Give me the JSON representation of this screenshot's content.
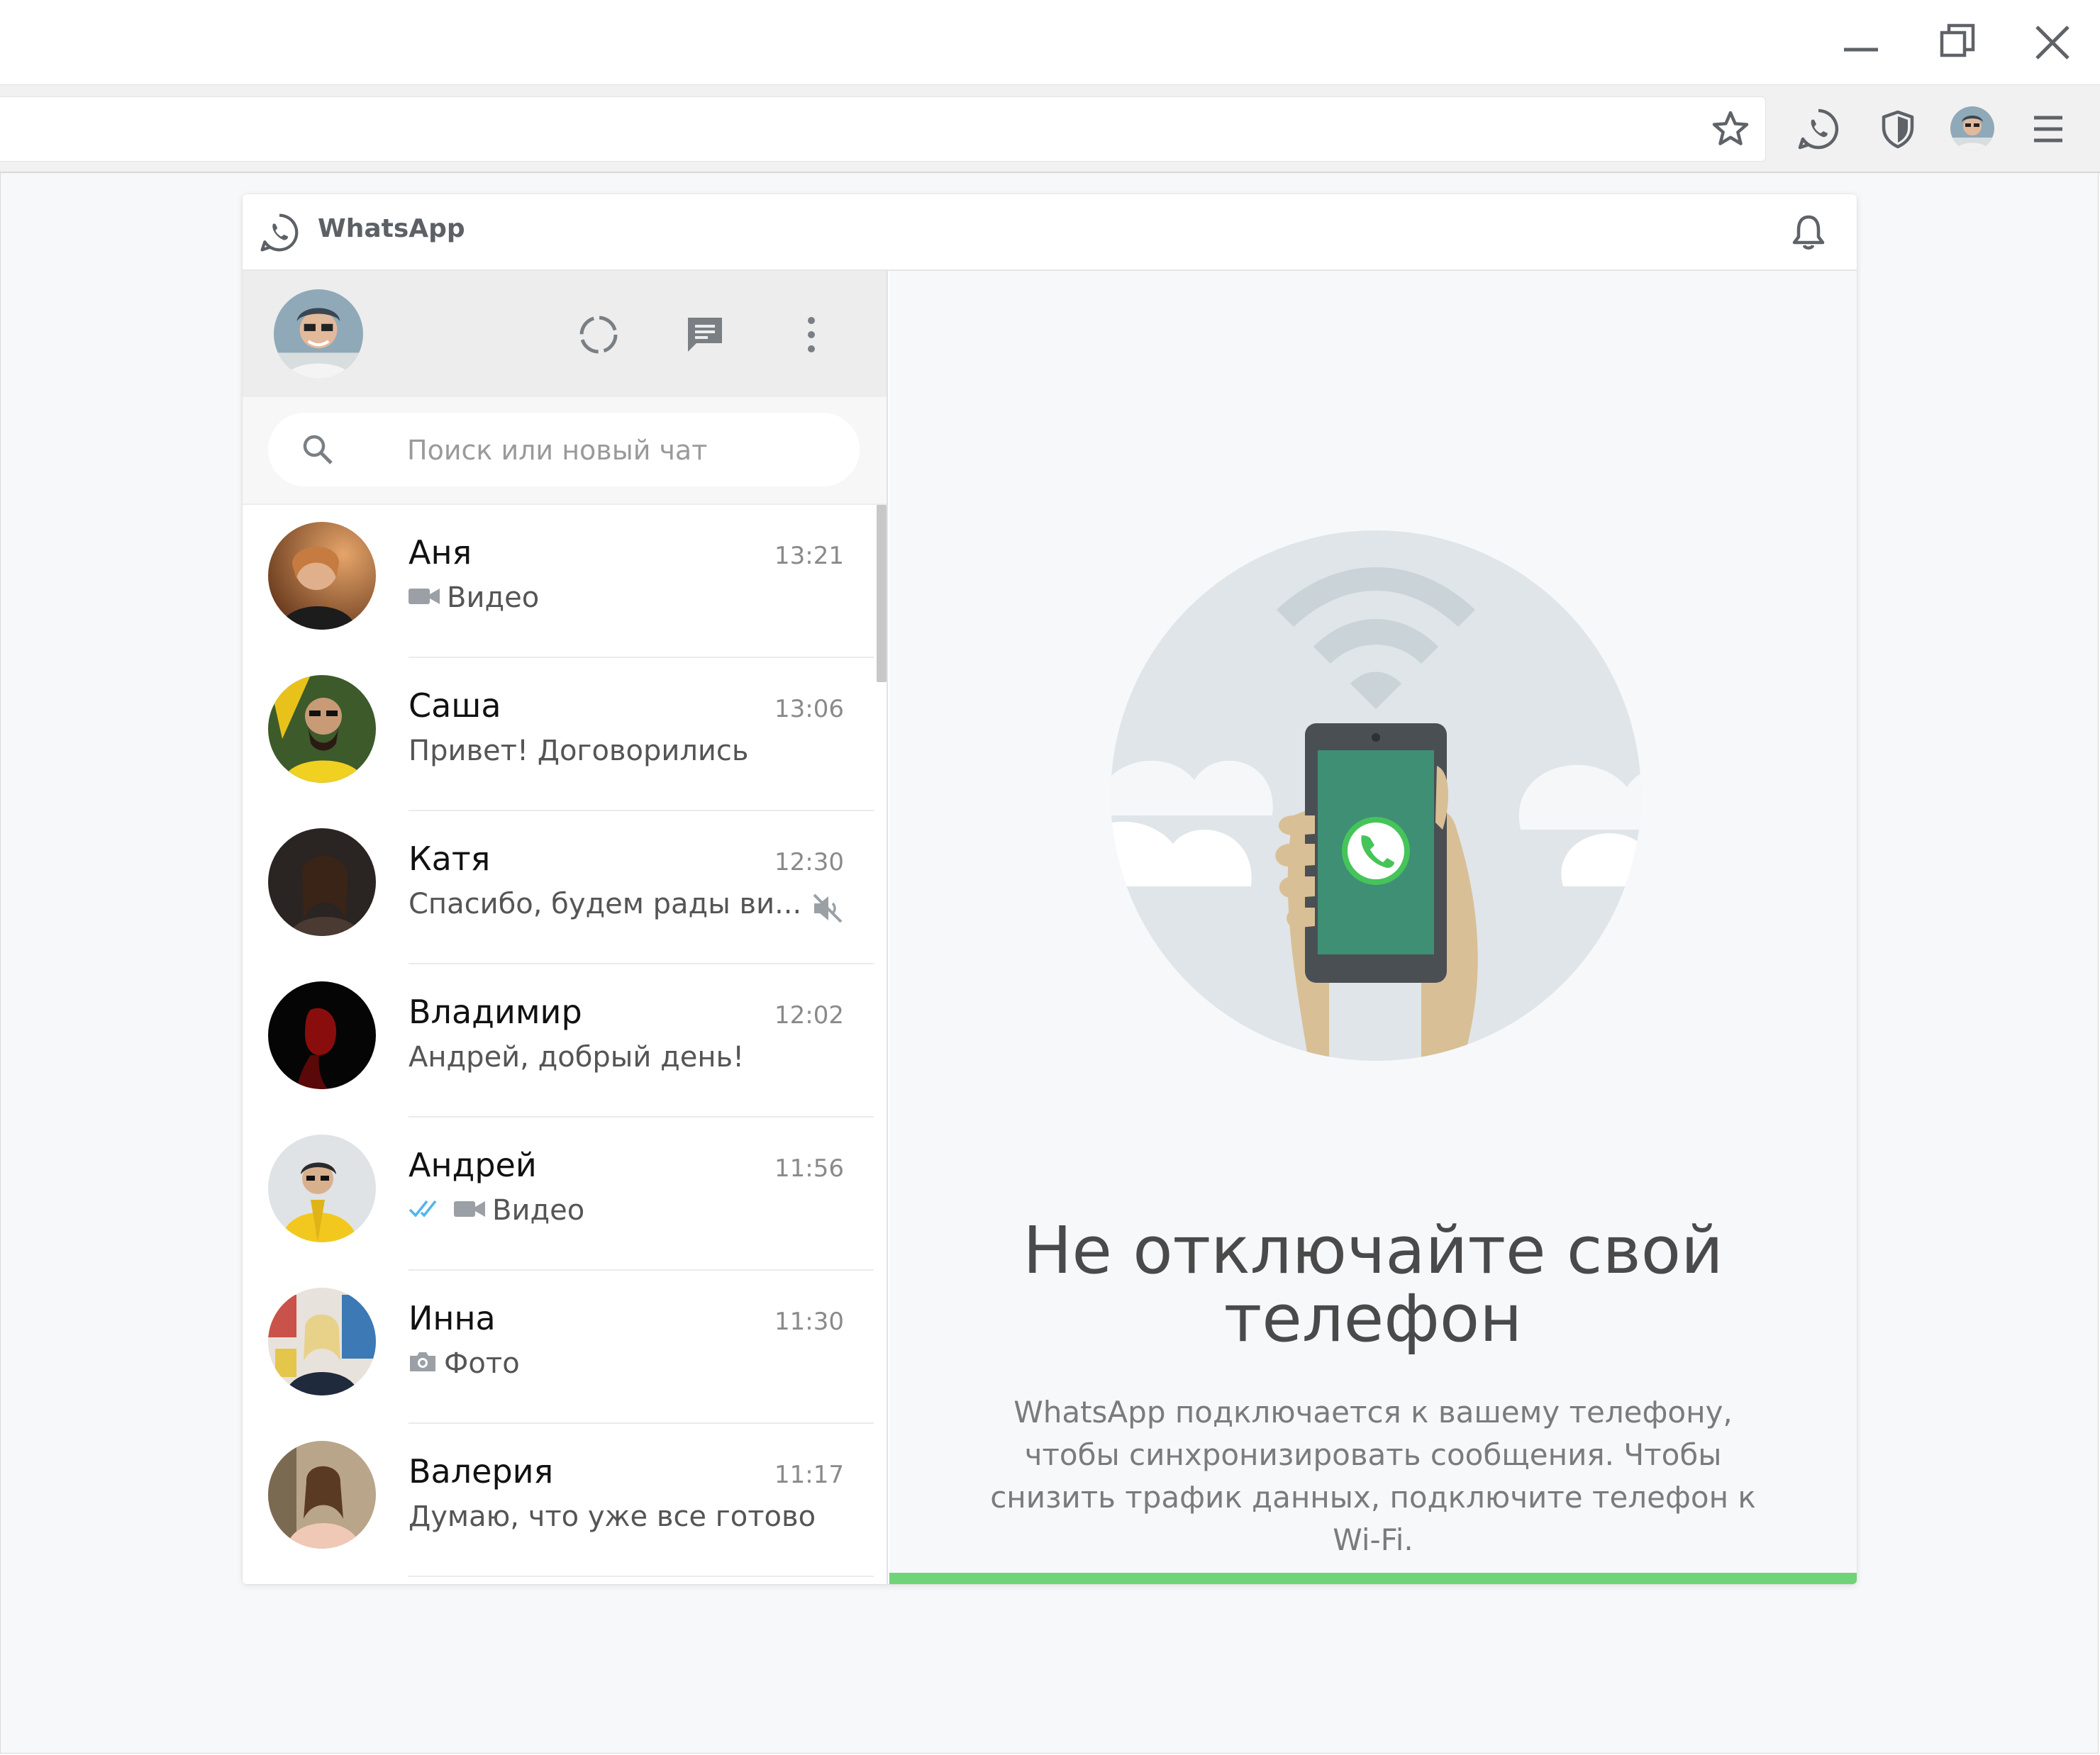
{
  "app": {
    "title": "WhatsApp",
    "accent_color": "#6fd478",
    "header_icon": "whatsapp-logo-icon"
  },
  "browser": {
    "window_controls": [
      "minimize-icon",
      "restore-icon",
      "close-icon"
    ],
    "toolbar_icons": [
      "star-icon",
      "whatsapp-extension-icon",
      "shield-icon",
      "profile-avatar",
      "menu-icon"
    ]
  },
  "sidebar": {
    "header_icons": [
      "status-icon",
      "new-chat-icon",
      "menu-dots-icon"
    ],
    "search": {
      "placeholder": "Поиск или новый чат"
    }
  },
  "chats": [
    {
      "name": "Аня",
      "time": "13:21",
      "preview": "Видео",
      "preview_icon": "video-icon"
    },
    {
      "name": "Саша",
      "time": "13:06",
      "preview": "Привет! Договорились"
    },
    {
      "name": "Катя",
      "time": "12:30",
      "preview": "Спасибо, будем рады ви...",
      "muted": true
    },
    {
      "name": "Владимир",
      "time": "12:02",
      "preview": "Андрей, добрый день!"
    },
    {
      "name": "Андрей",
      "time": "11:56",
      "preview": "Видео",
      "preview_icon": "video-icon",
      "read_receipt": true
    },
    {
      "name": "Инна",
      "time": "11:30",
      "preview": "Фото",
      "preview_icon": "camera-icon"
    },
    {
      "name": "Валерия",
      "time": "11:17",
      "preview": "Думаю, что уже все готово"
    }
  ],
  "main": {
    "title_line1": "Не отключайте свой",
    "title_line2": "телефон",
    "description": "WhatsApp подключается к вашему телефону, чтобы синхронизировать сообщения. Чтобы снизить трафик данных, подключите телефон к Wi-Fi."
  }
}
